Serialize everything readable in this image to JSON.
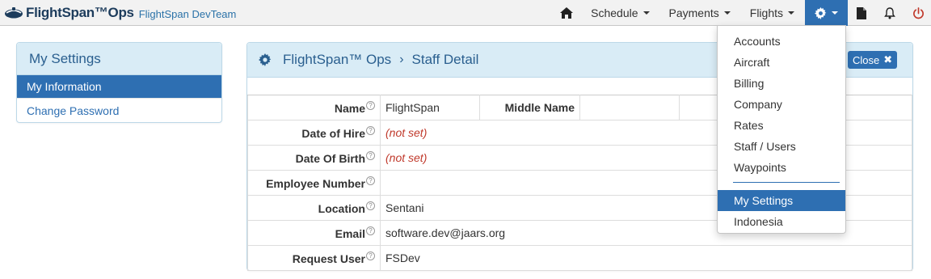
{
  "colors": {
    "accent": "#2e6fb2",
    "panel_header_bg": "#d9ecf6",
    "navbar_bg": "#f2f2f2",
    "not_set_text": "#c0392b"
  },
  "navbar": {
    "brand_name": "FlightSpan™Ops",
    "team_name": "FlightSpan DevTeam",
    "icons": {
      "home": "home-icon",
      "gear": "gear-icon",
      "document": "document-icon",
      "bell": "bell-icon",
      "power": "power-icon"
    },
    "menus": [
      "Schedule",
      "Payments",
      "Flights"
    ]
  },
  "settings_panel": {
    "title": "My Settings",
    "items": [
      {
        "label": "My Information",
        "active": true
      },
      {
        "label": "Change Password",
        "active": false
      }
    ]
  },
  "main_panel": {
    "breadcrumb": {
      "root": "FlightSpan™ Ops",
      "separator": "›",
      "current": "Staff Detail"
    },
    "close_label": "Close"
  },
  "staff_detail": {
    "name": {
      "label": "Name",
      "value": "FlightSpan"
    },
    "middle_name": {
      "label": "Middle Name",
      "value": ""
    },
    "date_of_hire": {
      "label": "Date of Hire",
      "value": "(not set)"
    },
    "date_of_birth": {
      "label": "Date Of Birth",
      "value": "(not set)"
    },
    "employee_number": {
      "label": "Employee Number",
      "value": ""
    },
    "location": {
      "label": "Location",
      "value": "Sentani"
    },
    "email": {
      "label": "Email",
      "value": "software.dev@jaars.org"
    },
    "request_user": {
      "label": "Request User",
      "value": "FSDev"
    }
  },
  "settings_dropdown": {
    "items": [
      "Accounts",
      "Aircraft",
      "Billing",
      "Company",
      "Rates",
      "Staff / Users",
      "Waypoints"
    ],
    "items_after_divider": [
      "My Settings",
      "Indonesia"
    ],
    "active_item": "My Settings"
  }
}
